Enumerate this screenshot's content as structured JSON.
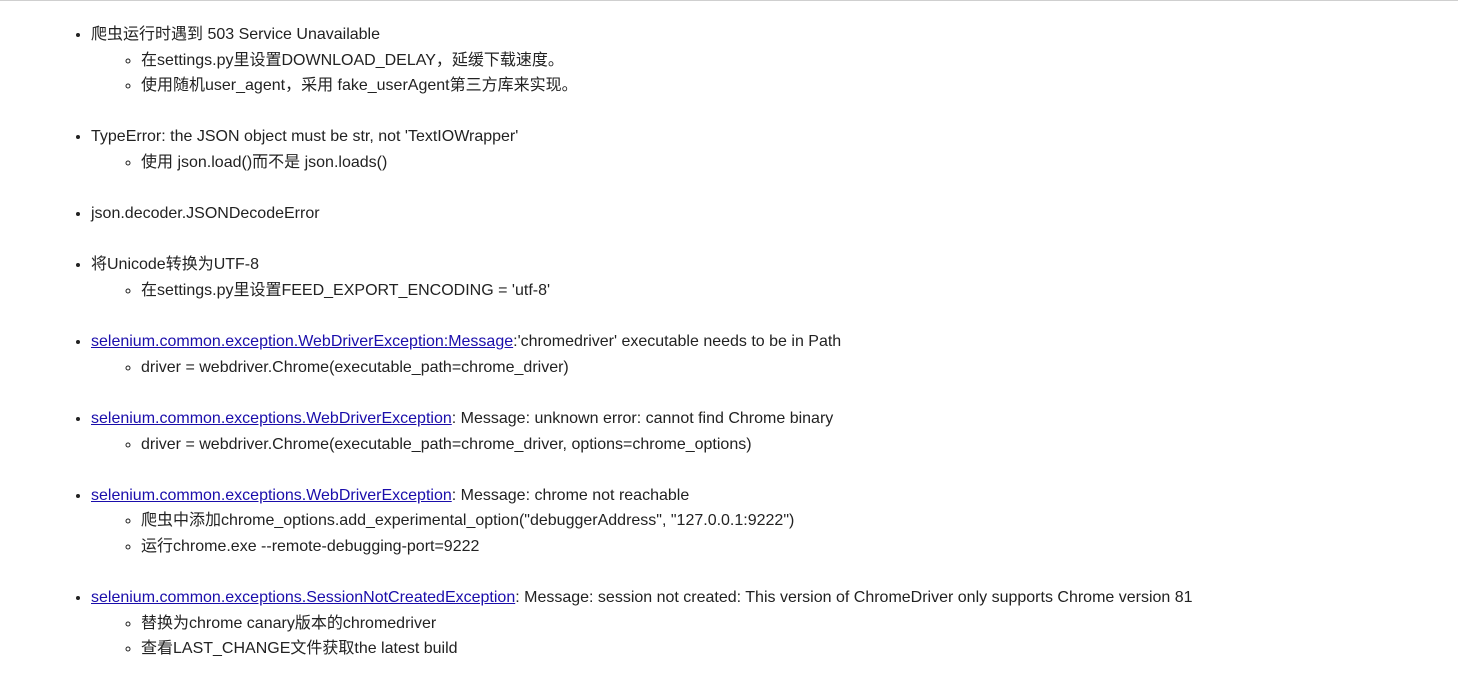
{
  "items": [
    {
      "link": "",
      "text": "爬虫运行时遇到 503 Service Unavailable",
      "subs": [
        "在settings.py里设置DOWNLOAD_DELAY，延缓下载速度。",
        "使用随机user_agent，采用 fake_userAgent第三方库来实现。"
      ]
    },
    {
      "link": "",
      "text": "TypeError: the JSON object must be str, not 'TextIOWrapper'",
      "subs": [
        "使用 json.load()而不是 json.loads()"
      ]
    },
    {
      "link": "",
      "text": "json.decoder.JSONDecodeError",
      "subs": []
    },
    {
      "link": "",
      "text": "将Unicode转换为UTF-8",
      "subs": [
        "在settings.py里设置FEED_EXPORT_ENCODING = 'utf-8'"
      ]
    },
    {
      "link": "selenium.common.exception.WebDriverException:Message",
      "text": ":'chromedriver' executable needs to be in Path",
      "subs": [
        "driver = webdriver.Chrome(executable_path=chrome_driver)"
      ]
    },
    {
      "link": "selenium.common.exceptions.WebDriverException",
      "text": ": Message: unknown error: cannot find Chrome binary",
      "subs": [
        "driver = webdriver.Chrome(executable_path=chrome_driver, options=chrome_options)"
      ]
    },
    {
      "link": "selenium.common.exceptions.WebDriverException",
      "text": ": Message: chrome not reachable",
      "subs": [
        "爬虫中添加chrome_options.add_experimental_option(\"debuggerAddress\", \"127.0.0.1:9222\")",
        "运行chrome.exe --remote-debugging-port=9222"
      ]
    },
    {
      "link": "selenium.common.exceptions.SessionNotCreatedException",
      "text": ": Message: session not created: This version of ChromeDriver only supports Chrome version 81",
      "subs": [
        "替换为chrome canary版本的chromedriver",
        "查看LAST_CHANGE文件获取the latest build"
      ]
    }
  ]
}
